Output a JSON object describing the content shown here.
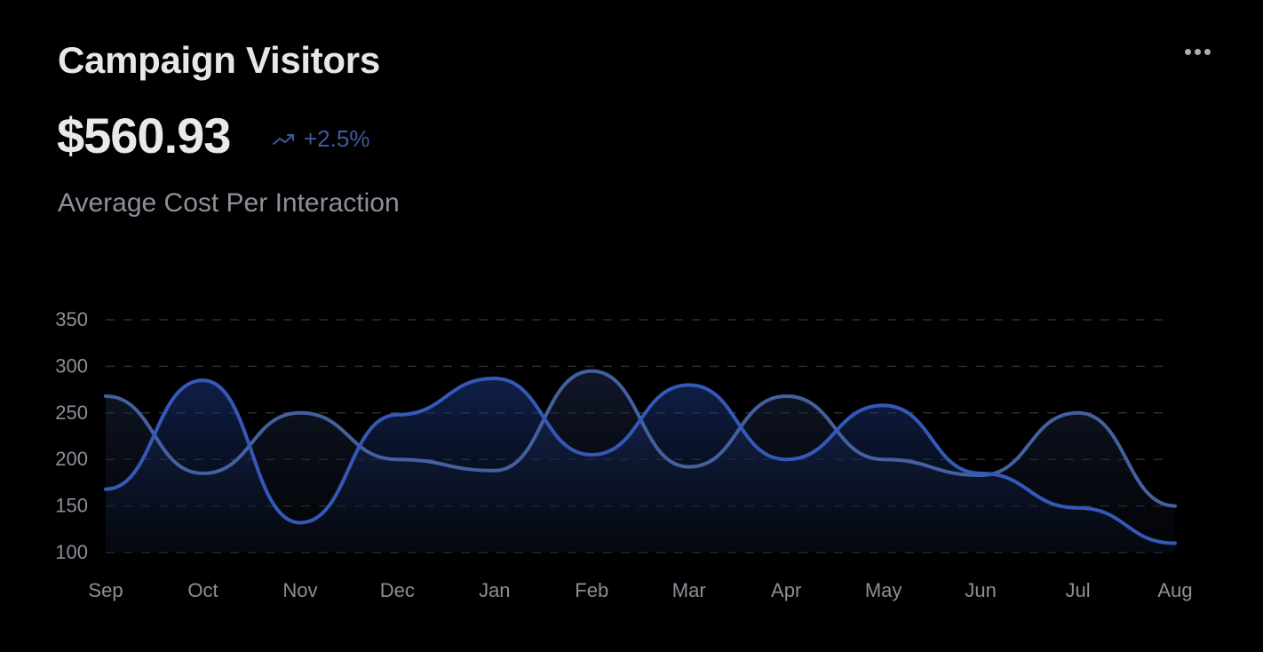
{
  "header": {
    "title": "Campaign Visitors",
    "value": "$560.93",
    "trend_icon": "trending-up-icon",
    "trend": "+2.5%",
    "subtitle": "Average Cost Per Interaction",
    "menu_icon": "more-horizontal-icon"
  },
  "colors": {
    "background": "#000000",
    "series_1": "#3559b8",
    "series_2": "#44609e",
    "trend": "#3f5a9e",
    "grid": "#2a2d34",
    "tick_text": "#8b8f99"
  },
  "chart_data": {
    "type": "area",
    "categories": [
      "Sep",
      "Oct",
      "Nov",
      "Dec",
      "Jan",
      "Feb",
      "Mar",
      "Apr",
      "May",
      "Jun",
      "Jul",
      "Aug"
    ],
    "series": [
      {
        "values": [
          168,
          285,
          132,
          248,
          287,
          205,
          280,
          200,
          258,
          185,
          148,
          110
        ]
      },
      {
        "values": [
          268,
          185,
          250,
          200,
          188,
          295,
          192,
          268,
          200,
          183,
          250,
          150
        ]
      }
    ],
    "ylim": [
      100,
      350
    ],
    "yticks": [
      "100",
      "150",
      "200",
      "250",
      "300",
      "350"
    ],
    "grid": true,
    "grid_style": "dashed",
    "legend": "none",
    "xlabel": "",
    "ylabel": ""
  }
}
